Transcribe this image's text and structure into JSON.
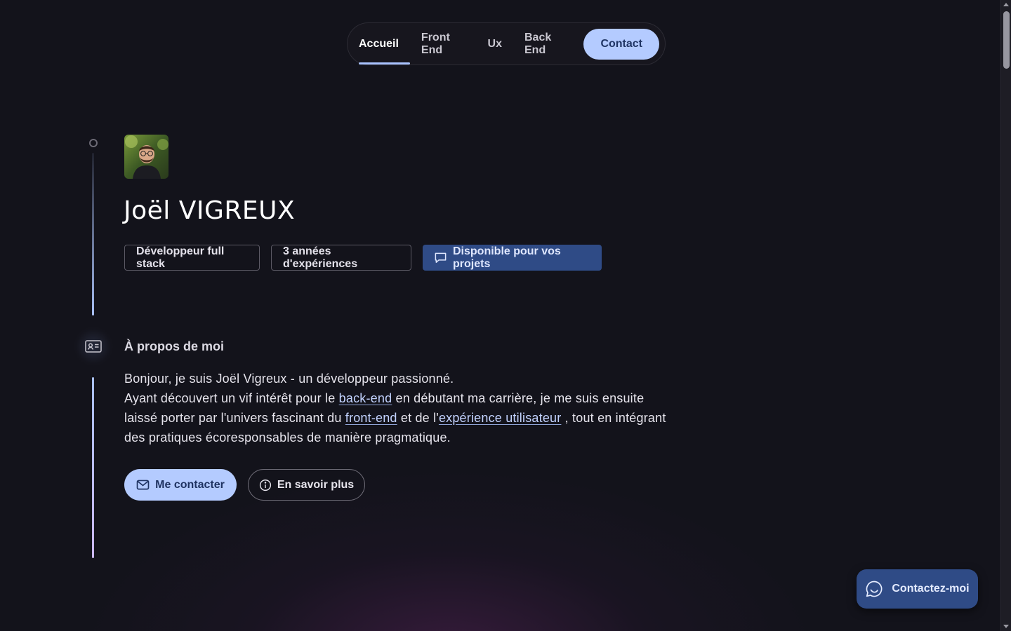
{
  "nav": {
    "items": [
      {
        "label": "Accueil",
        "active": true
      },
      {
        "label": "Front End",
        "active": false
      },
      {
        "label": "Ux",
        "active": false
      },
      {
        "label": "Back End",
        "active": false
      }
    ],
    "contact_label": "Contact"
  },
  "hero": {
    "name": "Joël VIGREUX",
    "chips": {
      "role": "Développeur full stack",
      "experience": "3 années d'expériences",
      "availability": "Disponible pour vos projets"
    }
  },
  "about": {
    "title": "À propos de moi",
    "line1": "Bonjour, je suis Joël Vigreux - un développeur passionné.",
    "p2_a": "Ayant découvert un vif intérêt pour le ",
    "link_backend": "back-end",
    "p2_b": " en débutant ma carrière, je me suis ensuite laissé porter par l'univers fascinant du ",
    "link_frontend": "front-end",
    "p2_c": " et de l'",
    "link_ux": "expérience utilisateur",
    "p2_d": " , tout en intégrant des pratiques écoresponsables de manière pragmatique."
  },
  "actions": {
    "contact_label": "Me contacter",
    "more_label": "En savoir plus"
  },
  "fab": {
    "label": "Contactez-moi"
  },
  "colors": {
    "background": "#13131b",
    "accent": "#b4cbff",
    "accent_dark": "#2f4b86"
  }
}
